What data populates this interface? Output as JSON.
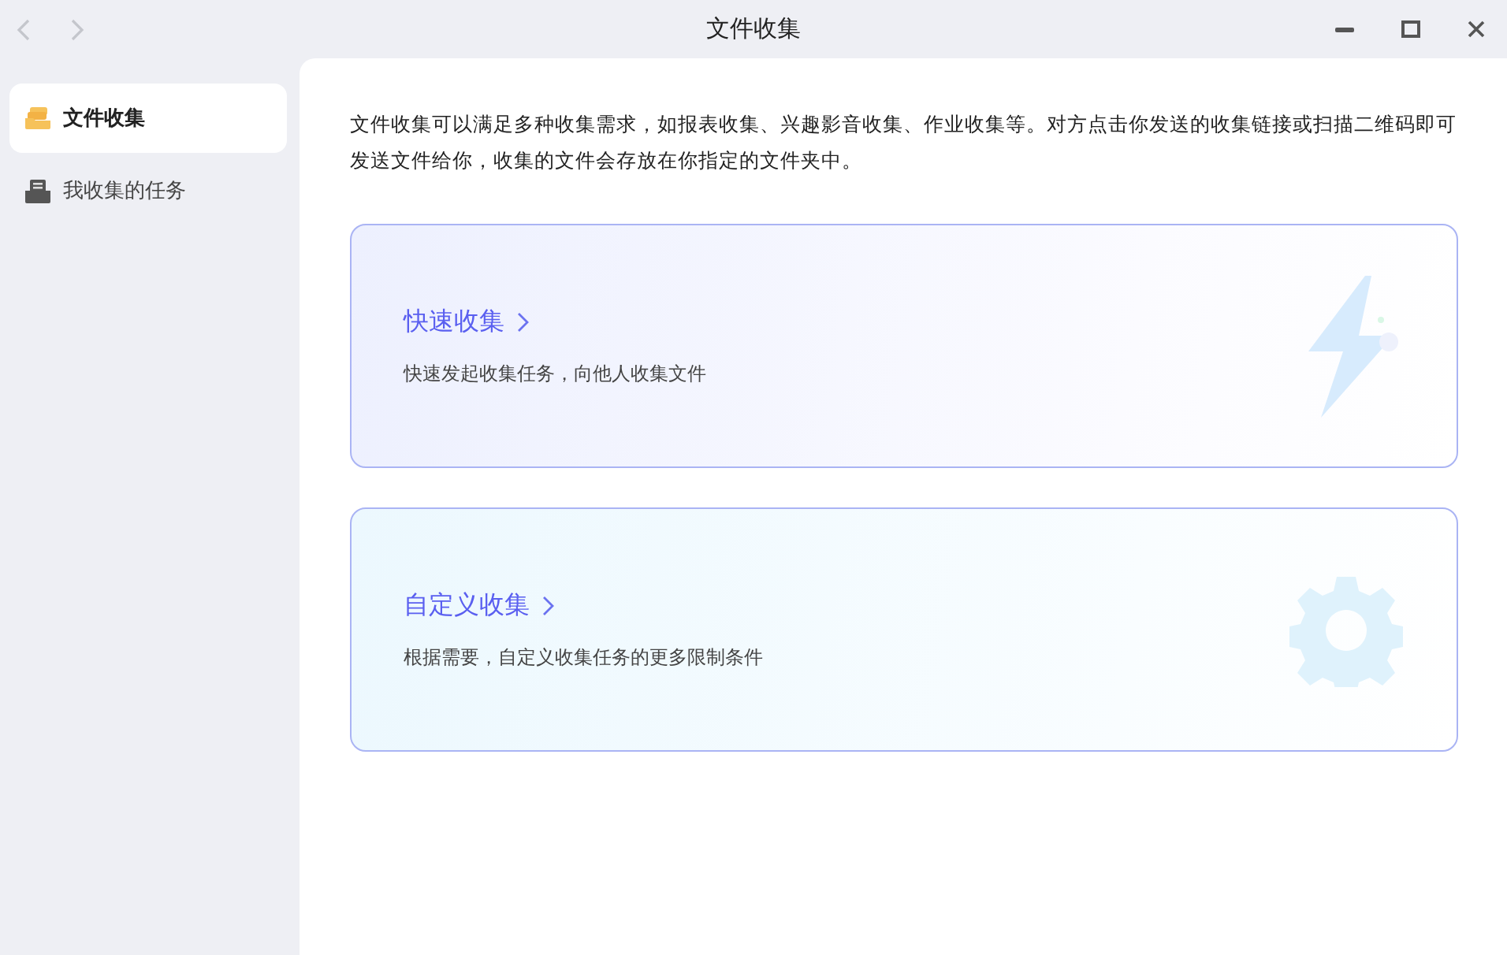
{
  "window": {
    "title": "文件收集"
  },
  "sidebar": {
    "items": [
      {
        "label": "文件收集",
        "kind": "folders",
        "selected": true
      },
      {
        "label": "我收集的任务",
        "kind": "tray",
        "selected": false
      }
    ]
  },
  "intro": "文件收集可以满足多种收集需求，如报表收集、兴趣影音收集、作业收集等。对方点击你发送的收集链接或扫描二维码即可发送文件给你，收集的文件会存放在你指定的文件夹中。",
  "cards": [
    {
      "kind": "quick",
      "title": "快速收集",
      "description": "快速发起收集任务，向他人收集文件"
    },
    {
      "kind": "custom",
      "title": "自定义收集",
      "description": "根据需要，自定义收集任务的更多限制条件"
    }
  ]
}
